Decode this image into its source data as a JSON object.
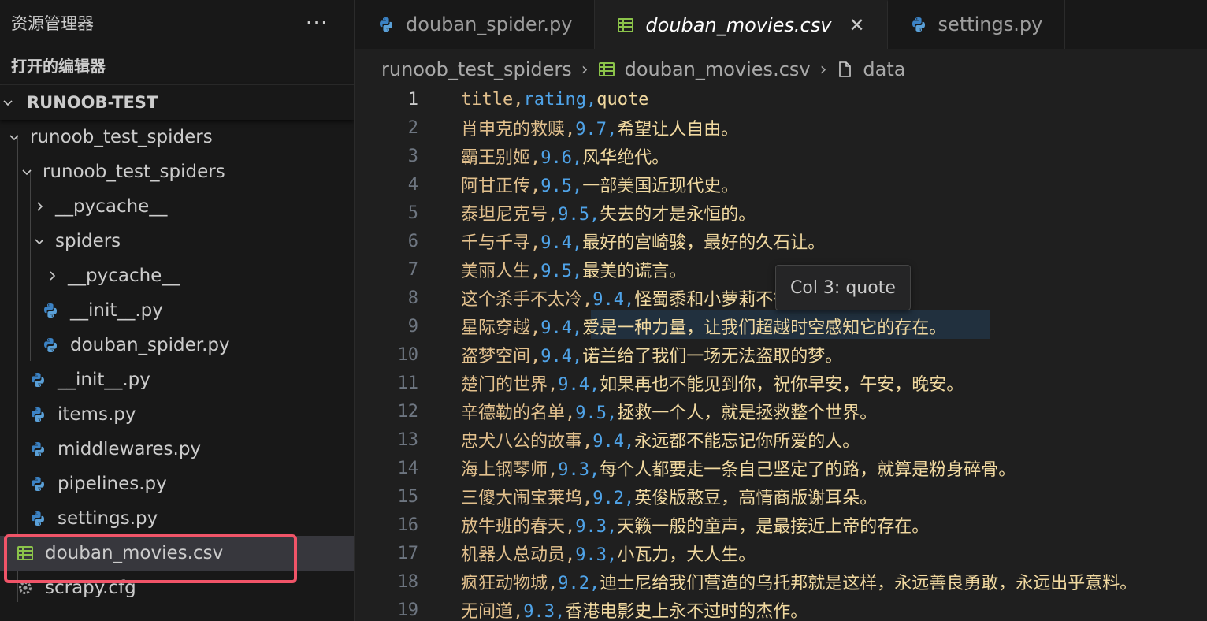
{
  "sidebar": {
    "title": "资源管理器",
    "more": "···",
    "open_editors": "打开的编辑器",
    "root": "RUNOOB-TEST",
    "items": [
      {
        "label": "runoob_test_spiders",
        "kind": "folder-open"
      },
      {
        "label": "runoob_test_spiders",
        "kind": "folder-open"
      },
      {
        "label": "__pycache__",
        "kind": "folder-closed"
      },
      {
        "label": "spiders",
        "kind": "folder-open"
      },
      {
        "label": "__pycache__",
        "kind": "folder-closed"
      },
      {
        "label": "__init__.py",
        "kind": "python"
      },
      {
        "label": "douban_spider.py",
        "kind": "python"
      },
      {
        "label": "__init__.py",
        "kind": "python"
      },
      {
        "label": "items.py",
        "kind": "python"
      },
      {
        "label": "middlewares.py",
        "kind": "python"
      },
      {
        "label": "pipelines.py",
        "kind": "python"
      },
      {
        "label": "settings.py",
        "kind": "python"
      },
      {
        "label": "douban_movies.csv",
        "kind": "csv"
      },
      {
        "label": "scrapy.cfg",
        "kind": "gear"
      }
    ]
  },
  "tabs": [
    {
      "label": "douban_spider.py",
      "icon": "python-icon"
    },
    {
      "label": "douban_movies.csv",
      "icon": "csv-icon",
      "close": "✕"
    },
    {
      "label": "settings.py",
      "icon": "python-icon"
    }
  ],
  "breadcrumb": {
    "folder": "runoob_test_spiders",
    "file": "douban_movies.csv",
    "symbol": "data"
  },
  "tooltip": "Col 3: quote",
  "colors": {
    "accent_highlight": "#f05468",
    "python_blue": "#3b82c4",
    "csv_green": "#8bc34a",
    "col1": "#e2c08d",
    "col2": "#4fa3e8",
    "col3": "#f1d9a0"
  },
  "lines": [
    {
      "n": "1",
      "a": "title,",
      "b": "rating,",
      "c": "quote"
    },
    {
      "n": "2",
      "a": "肖申克的救赎,",
      "b": "9.7,",
      "c": "希望让人自由。"
    },
    {
      "n": "3",
      "a": "霸王别姬,",
      "b": "9.6,",
      "c": "风华绝代。"
    },
    {
      "n": "4",
      "a": "阿甘正传,",
      "b": "9.5,",
      "c": "一部美国近现代史。"
    },
    {
      "n": "5",
      "a": "泰坦尼克号,",
      "b": "9.5,",
      "c": "失去的才是永恒的。"
    },
    {
      "n": "6",
      "a": "千与千寻,",
      "b": "9.4,",
      "c": "最好的宫崎骏，最好的久石让。"
    },
    {
      "n": "7",
      "a": "美丽人生,",
      "b": "9.5,",
      "c": "最美的谎言。"
    },
    {
      "n": "8",
      "a": "这个杀手不太冷,",
      "b": "9.4,",
      "c": "怪蜀黍和小萝莉不得不说的故事。"
    },
    {
      "n": "9",
      "a": "星际穿越,",
      "b": "9.4,",
      "c": "爱是一种力量，让我们超越时空感知它的存在。"
    },
    {
      "n": "10",
      "a": "盗梦空间,",
      "b": "9.4,",
      "c": "诺兰给了我们一场无法盗取的梦。"
    },
    {
      "n": "11",
      "a": "楚门的世界,",
      "b": "9.4,",
      "c": "如果再也不能见到你，祝你早安，午安，晚安。"
    },
    {
      "n": "12",
      "a": "辛德勒的名单,",
      "b": "9.5,",
      "c": "拯救一个人，就是拯救整个世界。"
    },
    {
      "n": "13",
      "a": "忠犬八公的故事,",
      "b": "9.4,",
      "c": "永远都不能忘记你所爱的人。"
    },
    {
      "n": "14",
      "a": "海上钢琴师,",
      "b": "9.3,",
      "c": "每个人都要走一条自己坚定了的路，就算是粉身碎骨。"
    },
    {
      "n": "15",
      "a": "三傻大闹宝莱坞,",
      "b": "9.2,",
      "c": "英俊版憨豆，高情商版谢耳朵。"
    },
    {
      "n": "16",
      "a": "放牛班的春天,",
      "b": "9.3,",
      "c": "天籁一般的童声，是最接近上帝的存在。"
    },
    {
      "n": "17",
      "a": "机器人总动员,",
      "b": "9.3,",
      "c": "小瓦力，大人生。"
    },
    {
      "n": "18",
      "a": "疯狂动物城,",
      "b": "9.2,",
      "c": "迪士尼给我们营造的乌托邦就是这样，永远善良勇敢，永远出乎意料。"
    },
    {
      "n": "19",
      "a": "无间道,",
      "b": "9.3,",
      "c": "香港电影史上永不过时的杰作。"
    }
  ]
}
